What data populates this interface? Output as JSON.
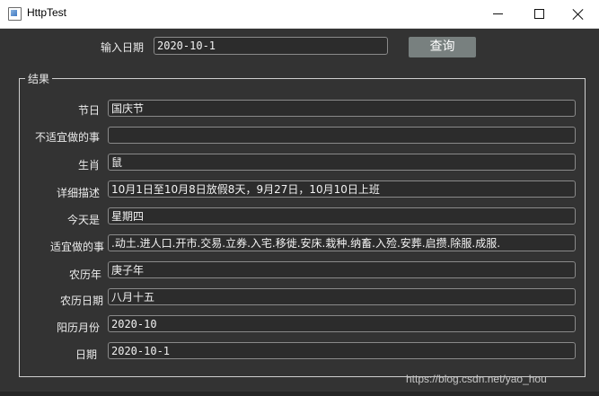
{
  "window": {
    "title": "HttpTest"
  },
  "query": {
    "date_label": "输入日期",
    "date_value": "2020-10-1",
    "button_label": "查询"
  },
  "result": {
    "title": "结果",
    "rows": [
      {
        "label": "节日",
        "value": "国庆节"
      },
      {
        "label": "不适宜做的事",
        "value": ""
      },
      {
        "label": "生肖",
        "value": "鼠"
      },
      {
        "label": "详细描述",
        "value": "10月1日至10月8日放假8天，9月27日，10月10日上班"
      },
      {
        "label": "今天是",
        "value": "星期四"
      },
      {
        "label": "适宜做的事",
        "value": ".动土.进人口.开市.交易.立券.入宅.移徙.安床.栽种.纳畜.入殓.安葬.启攒.除服.成服."
      },
      {
        "label": "农历年",
        "value": "庚子年"
      },
      {
        "label": "农历日期",
        "value": "八月十五"
      },
      {
        "label": "阳历月份",
        "value": "2020-10"
      },
      {
        "label": "日期",
        "value": "2020-10-1"
      }
    ]
  },
  "watermark": "https://blog.csdn.net/yao_hou"
}
